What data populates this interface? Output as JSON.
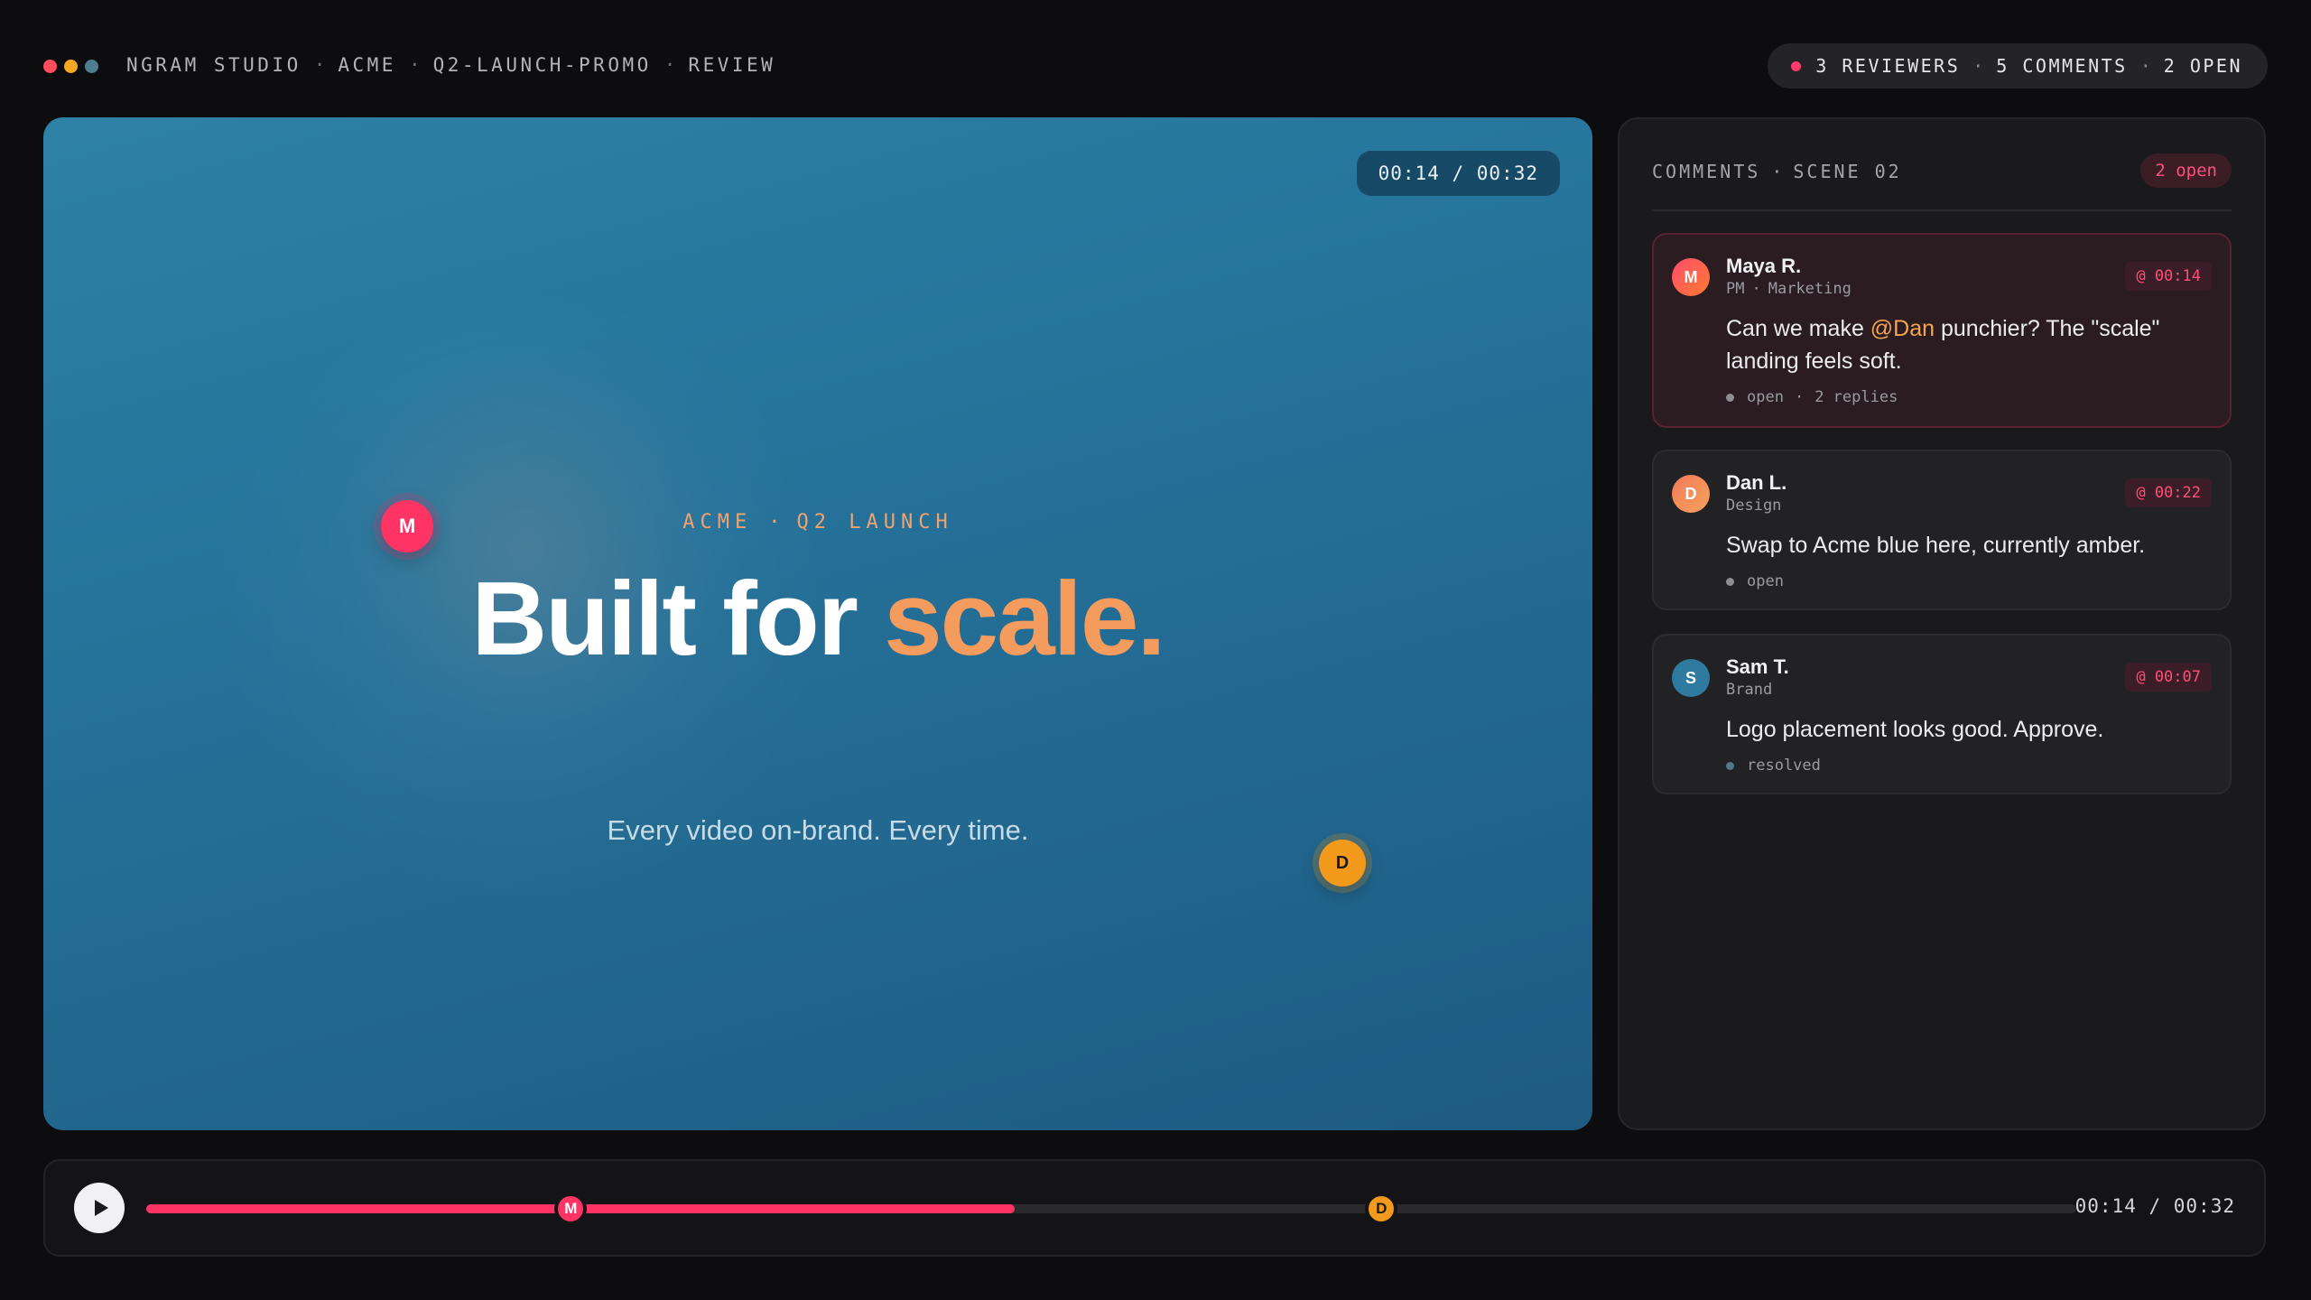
{
  "header": {
    "breadcrumb": [
      "NGRAM STUDIO",
      "ACME",
      "Q2-LAUNCH-PROMO",
      "REVIEW"
    ],
    "separator": "·",
    "stats": {
      "reviewers": "3 REVIEWERS",
      "comments": "5 COMMENTS",
      "open": "2 OPEN"
    },
    "traffic_colors": [
      "#ff4d5e",
      "#f5a623",
      "#4c7d91"
    ]
  },
  "video": {
    "timecode": "00:14 / 00:32",
    "kicker_parts": [
      "ACME",
      "Q2 LAUNCH"
    ],
    "headline_main": "Built for ",
    "headline_accent": "scale.",
    "subline": "Every video on-brand. Every time.",
    "pins": [
      {
        "initial": "M"
      },
      {
        "initial": "D"
      }
    ]
  },
  "comments_panel": {
    "title_parts": [
      "COMMENTS",
      "SCENE 02"
    ],
    "open_badge": "2 open",
    "comments": [
      {
        "initial": "M",
        "author": "Maya R.",
        "role_parts": [
          "PM",
          "Marketing"
        ],
        "timestamp": "@ 00:14",
        "text_before": "Can we make ",
        "mention": "@Dan",
        "text_after": " punchier? The \"scale\" landing feels soft.",
        "status": "open",
        "replies": "2 replies",
        "avatar_color": "#ff5a3c",
        "active": true
      },
      {
        "initial": "D",
        "author": "Dan L.",
        "role_parts": [
          "Design"
        ],
        "timestamp": "@ 00:22",
        "text": "Swap to Acme blue here, currently amber.",
        "status": "open",
        "avatar_color": "#f0885a",
        "active": false
      },
      {
        "initial": "S",
        "author": "Sam T.",
        "role_parts": [
          "Brand"
        ],
        "timestamp": "@ 00:07",
        "text": "Logo placement looks good. Approve.",
        "status": "resolved",
        "avatar_color": "#2f7ba0",
        "active": false
      }
    ]
  },
  "timeline": {
    "current": "00:14",
    "duration": "00:32",
    "display": "00:14 / 00:32",
    "progress_fraction": 0.45,
    "markers": [
      {
        "initial": "M",
        "fraction": 0.22
      },
      {
        "initial": "D",
        "fraction": 0.64
      }
    ]
  },
  "colors": {
    "accent": "#ff3465",
    "amber": "#f39a1c",
    "headline_accent": "#f49b5e"
  }
}
